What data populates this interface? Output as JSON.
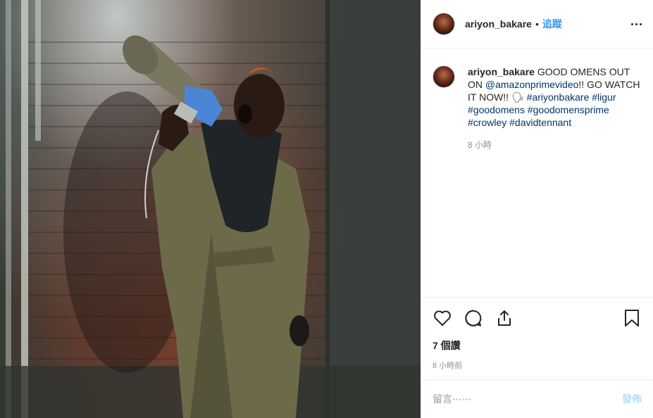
{
  "post": {
    "username": "ariyon_bakare",
    "follow_label": "追蹤",
    "dot": "•",
    "caption": {
      "username": "ariyon_bakare",
      "text_1": " GOOD OMENS OUT ON ",
      "mention": "@amazonprimevideo",
      "text_2": "!! GO WATCH IT NOW!! 🗣",
      "hashtags": [
        "#ariyonbakare",
        "#ligur",
        "#goodomens",
        "#goodomensprime",
        "#crowley",
        "#davidtennant"
      ],
      "time": "8 小時"
    },
    "views": "7 個讚",
    "time_ago": "8 小時前",
    "comment_placeholder": "留言⋯⋯",
    "post_label": "發佈"
  },
  "colors": {
    "follow_blue": "#3897f0",
    "link_blue": "#003569",
    "post_disabled": "#b2dffc",
    "muted_gray": "#8e8e8e",
    "border": "#efefef"
  },
  "icons": [
    "more-options-icon",
    "heart-icon",
    "comment-icon",
    "share-icon",
    "bookmark-icon"
  ]
}
